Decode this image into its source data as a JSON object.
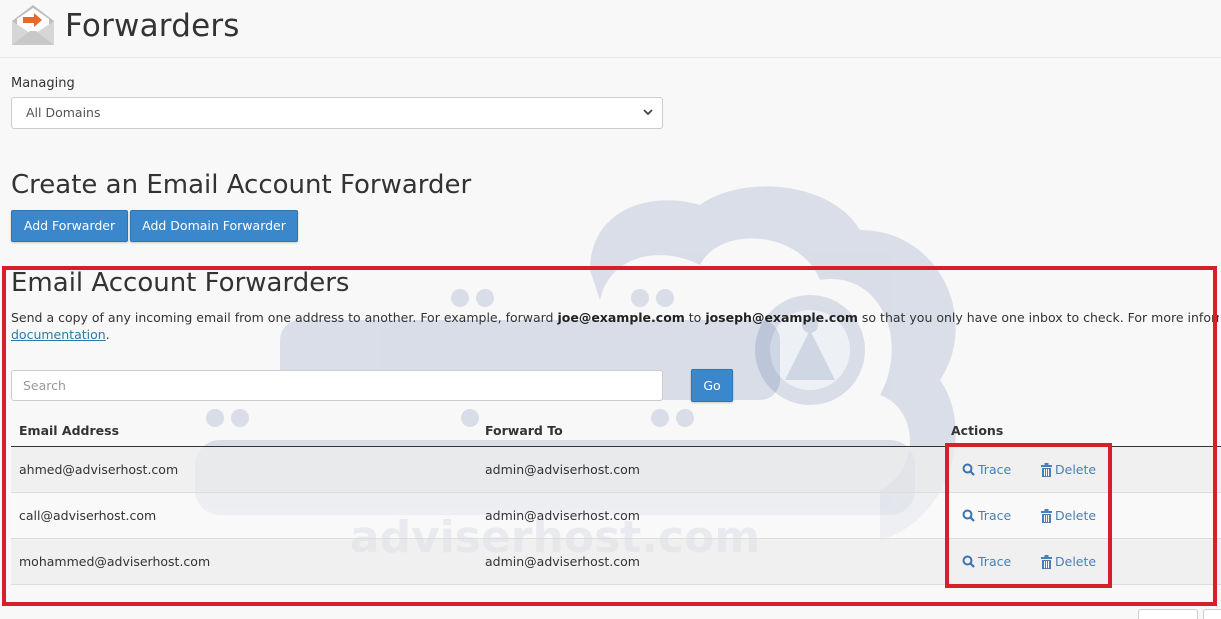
{
  "header": {
    "title": "Forwarders",
    "icon": "email-forward-icon"
  },
  "managing": {
    "label": "Managing",
    "selected": "All Domains"
  },
  "create_section": {
    "title": "Create an Email Account Forwarder",
    "add_forwarder_label": "Add Forwarder",
    "add_domain_forwarder_label": "Add Domain Forwarder"
  },
  "forwarders_section": {
    "title": "Email Account Forwarders",
    "desc_part1": "Send a copy of any incoming email from one address to another. For example, forward ",
    "desc_bold1": "joe@example.com",
    "desc_part2": " to ",
    "desc_bold2": "joseph@example.com",
    "desc_part3": " so that you only have one inbox to check. For more information, read the",
    "doc_link": "documentation",
    "doc_suffix": ".",
    "search_placeholder": "Search",
    "go_label": "Go"
  },
  "table": {
    "columns": [
      "Email Address",
      "Forward To",
      "Actions"
    ],
    "rows": [
      {
        "email": "ahmed@adviserhost.com",
        "forward_to": "admin@adviserhost.com",
        "trace": "Trace",
        "delete": "Delete"
      },
      {
        "email": "call@adviserhost.com",
        "forward_to": "admin@adviserhost.com",
        "trace": "Trace",
        "delete": "Delete"
      },
      {
        "email": "mohammed@adviserhost.com",
        "forward_to": "admin@adviserhost.com",
        "trace": "Trace",
        "delete": "Delete"
      }
    ]
  },
  "watermark": {
    "text": "adviserhost.com"
  },
  "colors": {
    "primary_button": "#3a87cc",
    "link": "#2a7aa8",
    "action_link": "#4a7fb5",
    "highlight_border": "#d4202b",
    "watermark": "#c5cde0"
  }
}
